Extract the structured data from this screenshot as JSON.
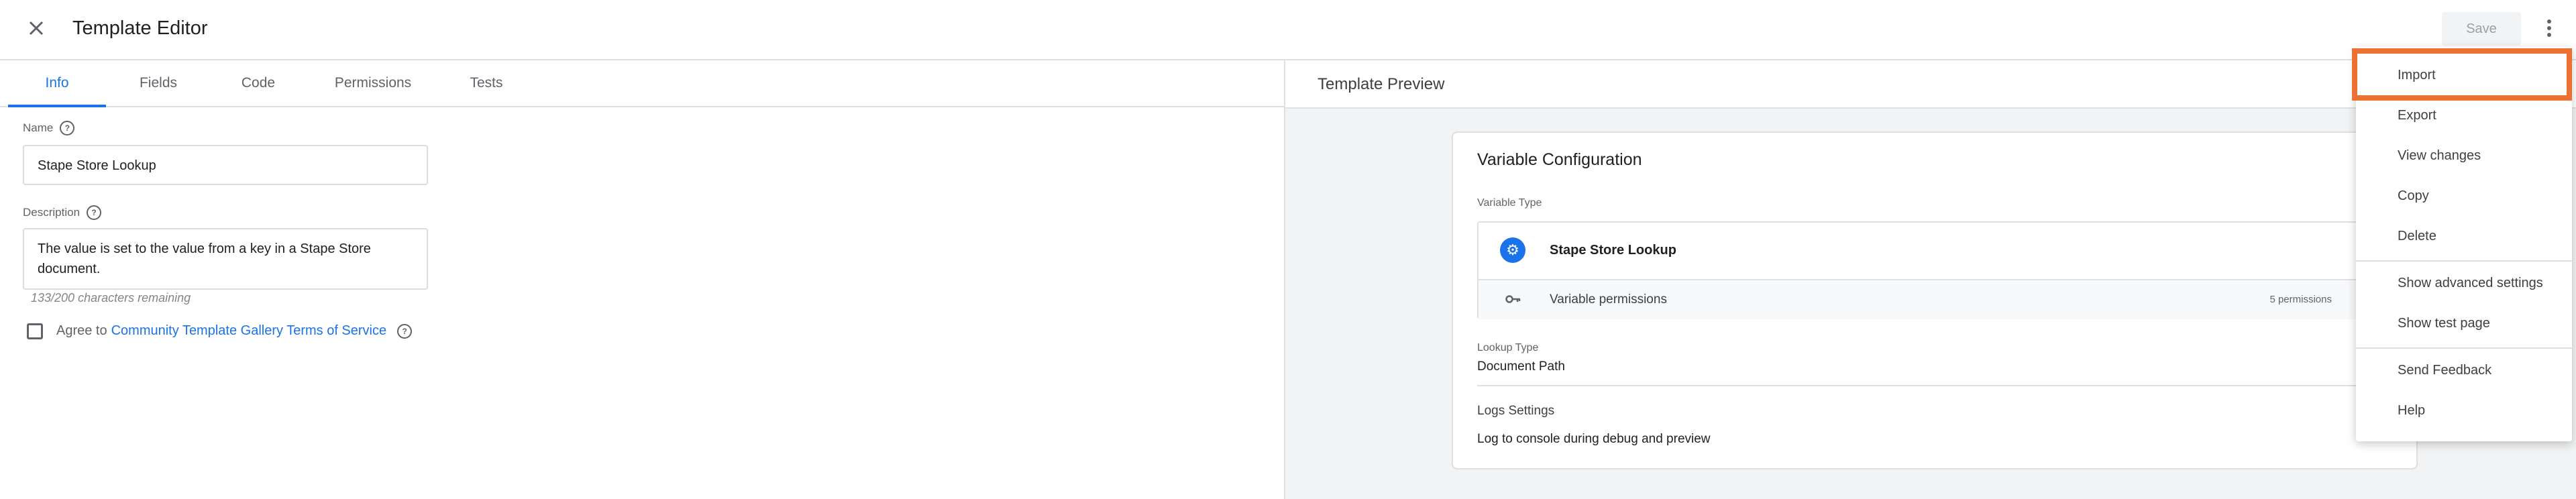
{
  "header": {
    "title": "Template Editor",
    "save_label": "Save",
    "close_icon": "close-icon",
    "more_icon": "more-vert-icon"
  },
  "tabs": [
    {
      "label": "Info",
      "active": true
    },
    {
      "label": "Fields",
      "active": false
    },
    {
      "label": "Code",
      "active": false
    },
    {
      "label": "Permissions",
      "active": false
    },
    {
      "label": "Tests",
      "active": false
    }
  ],
  "info": {
    "name_label": "Name",
    "name_value": "Stape Store Lookup",
    "description_label": "Description",
    "description_value": "The value is set to the value from a key in a Stape Store document.",
    "chars_remaining": "133/200 characters remaining",
    "agree_prefix": "Agree to",
    "agree_link": "Community Template Gallery Terms of Service"
  },
  "preview": {
    "title": "Template Preview",
    "card_title": "Variable Configuration",
    "variable_type_label": "Variable Type",
    "variable_name": "Stape Store Lookup",
    "permissions_label": "Variable permissions",
    "permissions_count": "5 permissions",
    "lookup_type_label": "Lookup Type",
    "lookup_type_value": "Document Path",
    "logs_label": "Logs Settings",
    "logs_value": "Log to console during debug and preview"
  },
  "menu": {
    "items": [
      {
        "label": "Import"
      },
      {
        "label": "Export"
      },
      {
        "label": "View changes"
      },
      {
        "label": "Copy"
      },
      {
        "label": "Delete"
      },
      {
        "label": "Show advanced settings"
      },
      {
        "label": "Show test page"
      },
      {
        "label": "Send Feedback"
      },
      {
        "label": "Help"
      }
    ],
    "highlighted": "Import",
    "highlight_color": "#ea7132"
  },
  "colors": {
    "accent": "#1a73e8",
    "highlight": "#ea7132"
  }
}
